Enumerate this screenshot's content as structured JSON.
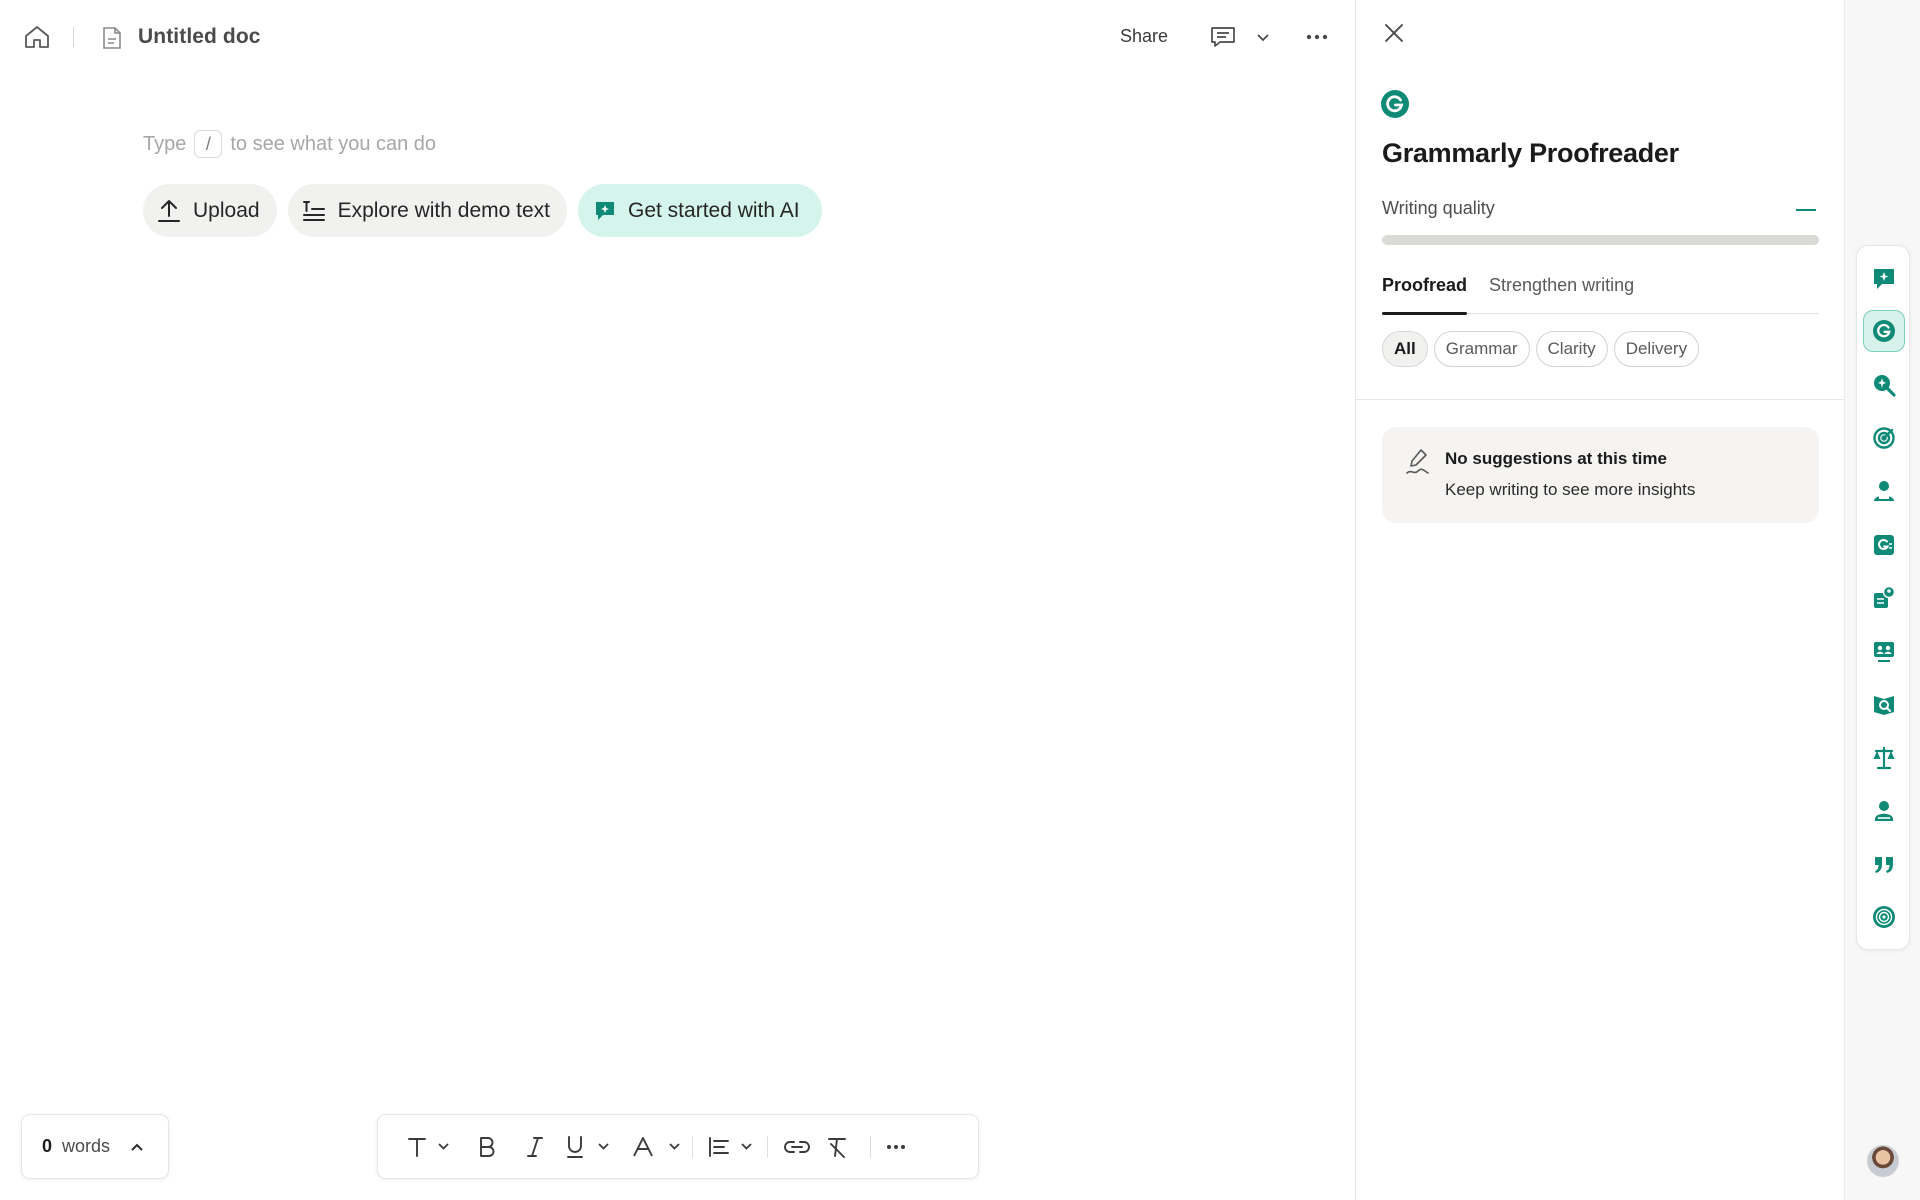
{
  "topbar": {
    "doc_title": "Untitled doc",
    "share_label": "Share"
  },
  "editor": {
    "placeholder_before": "Type",
    "placeholder_key": "/",
    "placeholder_after": "to see what you can do",
    "actions": [
      {
        "label": "Upload",
        "icon": "upload-icon"
      },
      {
        "label": "Explore with demo text",
        "icon": "text-lines-icon"
      },
      {
        "label": "Get started with AI",
        "icon": "ai-chat-icon"
      }
    ]
  },
  "footer": {
    "word_count": "0",
    "word_label": "words"
  },
  "toolbar": {
    "items": [
      "text-style-icon",
      "bold-icon",
      "italic-icon",
      "underline-icon",
      "text-color-icon",
      "align-icon",
      "link-icon",
      "clear-format-icon",
      "more-icon"
    ]
  },
  "panel": {
    "title": "Grammarly Proofreader",
    "writing_quality_label": "Writing quality",
    "writing_quality_value": 0,
    "tabs": [
      {
        "label": "Proofread",
        "active": true
      },
      {
        "label": "Strengthen writing",
        "active": false
      }
    ],
    "filters": [
      {
        "label": "All",
        "active": true
      },
      {
        "label": "Grammar",
        "active": false
      },
      {
        "label": "Clarity",
        "active": false
      },
      {
        "label": "Delivery",
        "active": false
      }
    ],
    "empty_title": "No suggestions at this time",
    "empty_subtitle": "Keep writing to see more insights"
  },
  "rail": {
    "icons": [
      "ai-chat-icon",
      "grammarly-icon",
      "search-insights-icon",
      "target-icon",
      "reader-icon",
      "grammar-check-icon",
      "expert-review-icon",
      "audience-icon",
      "detector-icon",
      "balance-icon",
      "humanizer-icon",
      "quote-icon",
      "fingerprint-icon"
    ]
  },
  "colors": {
    "accent": "#0f8a76",
    "ai_button_bg": "#d5f4ec",
    "card_bg": "#f5f4f2"
  }
}
